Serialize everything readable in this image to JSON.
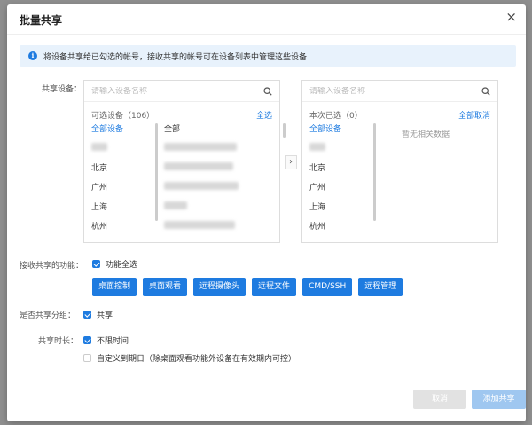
{
  "dialog": {
    "title": "批量共享",
    "close_label": "×",
    "info_text": "将设备共享给已勾选的帐号，接收共享的帐号可在设备列表中管理这些设备"
  },
  "share_devices": {
    "label": "共享设备：",
    "available": {
      "search_placeholder": "请输入设备名称",
      "count_label": "可选设备（106）",
      "select_all": "全选",
      "groups": [
        "全部设备",
        "",
        "北京",
        "广州",
        "上海",
        "杭州"
      ],
      "devices_header": "全部"
    },
    "selected": {
      "search_placeholder": "请输入设备名称",
      "count_label": "本次已选（0）",
      "cancel_all": "全部取消",
      "groups": [
        "全部设备",
        "",
        "北京",
        "广州",
        "上海",
        "杭州"
      ],
      "empty_text": "暂无相关数据"
    },
    "transfer_arrow": "›"
  },
  "functions": {
    "label": "接收共享的功能：",
    "select_all_label": "功能全选",
    "buttons": [
      "桌面控制",
      "桌面观看",
      "远程摄像头",
      "远程文件",
      "CMD/SSH",
      "远程管理"
    ]
  },
  "group_share": {
    "label": "是否共享分组：",
    "option": "共享"
  },
  "duration": {
    "label": "共享时长：",
    "unlimited": "不限时间",
    "custom": "自定义到期日（除桌面观看功能外设备在有效期内可控）"
  },
  "footer": {
    "cancel": "取消",
    "add": "添加共享"
  },
  "colors": {
    "accent": "#1e7be0",
    "info_bg": "#e8f2fc",
    "disabled_add": "#9fc7f0"
  }
}
